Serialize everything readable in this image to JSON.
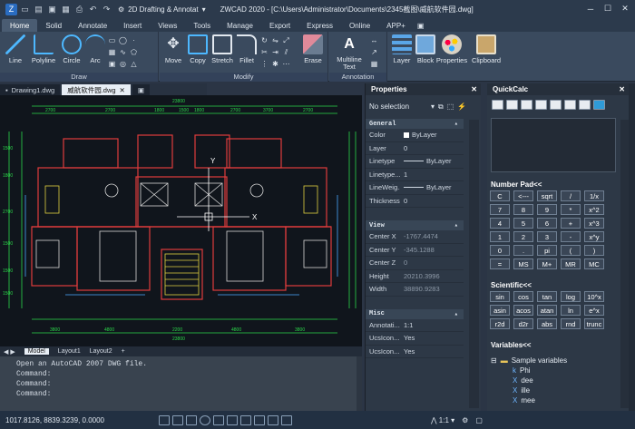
{
  "app": {
    "workspace": "2D Drafting & Annotat",
    "title": "ZWCAD 2020 - [C:\\Users\\Administrator\\Documents\\2345截图\\威航软件园.dwg]"
  },
  "menu_tabs": [
    "Home",
    "Solid",
    "Annotate",
    "Insert",
    "Views",
    "Tools",
    "Manage",
    "Export",
    "Express",
    "Online",
    "APP+"
  ],
  "ribbon": {
    "draw_tools": [
      "Line",
      "Polyline",
      "Circle",
      "Arc"
    ],
    "draw_label": "Draw",
    "modify_tools": [
      "Move",
      "Copy",
      "Stretch",
      "Fillet",
      "Erase"
    ],
    "modify_label": "Modify",
    "annotation_tools": [
      "Multiline\nText"
    ],
    "annotation_label": "Annotation",
    "panel_tools": [
      "Layer",
      "Block",
      "Properties",
      "Clipboard"
    ]
  },
  "file_tabs": [
    "Drawing1.dwg",
    "威航软件园.dwg"
  ],
  "drawing": {
    "dims_top": [
      "23800",
      "2700",
      "2700",
      "1800",
      "1500",
      "1800",
      "2700",
      "3700",
      "2700"
    ],
    "dims_bottom": [
      "3800",
      "4800",
      "2200",
      "4800",
      "3800",
      "23800"
    ],
    "dims_left": [
      "1500",
      "1800",
      "2700",
      "1500",
      "1500",
      "1500"
    ],
    "axis_x": "X",
    "axis_y": "Y"
  },
  "layout_tabs": [
    "Model",
    "Layout1",
    "Layout2",
    "+"
  ],
  "command": {
    "lines": [
      "Open an AutoCAD 2007 DWG file.",
      "Command:",
      "Command:",
      "Command:"
    ]
  },
  "status": {
    "coords": "1017.8126, 8839.3239, 0.0000"
  },
  "properties": {
    "title": "Properties",
    "selection": "No selection",
    "general_label": "General",
    "general": [
      {
        "key": "Color",
        "value": "ByLayer"
      },
      {
        "key": "Layer",
        "value": "0"
      },
      {
        "key": "Linetype",
        "value": "ByLayer"
      },
      {
        "key": "Linetype...",
        "value": "1"
      },
      {
        "key": "LineWeig...",
        "value": "ByLayer"
      },
      {
        "key": "Thickness",
        "value": "0"
      }
    ],
    "view_label": "View",
    "view": [
      {
        "key": "Center X",
        "value": "-1767.4474"
      },
      {
        "key": "Center Y",
        "value": "-345.1288"
      },
      {
        "key": "Center Z",
        "value": "0"
      },
      {
        "key": "Height",
        "value": "20210.3996"
      },
      {
        "key": "Width",
        "value": "38890.9283"
      }
    ],
    "misc_label": "Misc",
    "misc": [
      {
        "key": "Annotati...",
        "value": "1:1"
      },
      {
        "key": "UcsIcon...",
        "value": "Yes"
      },
      {
        "key": "UcsIcon...",
        "value": "Yes"
      }
    ]
  },
  "quickcalc": {
    "title": "QuickCalc",
    "numpad_label": "Number Pad<<",
    "numpad": [
      "C",
      "<---",
      "sqrt",
      "/",
      "1/x",
      "7",
      "8",
      "9",
      "*",
      "x^2",
      "4",
      "5",
      "6",
      "+",
      "x^3",
      "1",
      "2",
      "3",
      "-",
      "x^y",
      "0",
      ".",
      "pi",
      "(",
      ")",
      "=",
      "MS",
      "M+",
      "MR",
      "MC"
    ],
    "sci_label": "Scientific<<",
    "sci": [
      "sin",
      "cos",
      "tan",
      "log",
      "10^x",
      "asin",
      "acos",
      "atan",
      "ln",
      "e^x",
      "r2d",
      "d2r",
      "abs",
      "rnd",
      "trunc"
    ],
    "vars_label": "Variables<<",
    "vars_root": "Sample variables",
    "vars": [
      "Phi",
      "dee",
      "ille",
      "mee"
    ]
  },
  "colors": {
    "accent": "#2f9bd8",
    "bg": "#2b3545",
    "canvas": "#10151c"
  }
}
